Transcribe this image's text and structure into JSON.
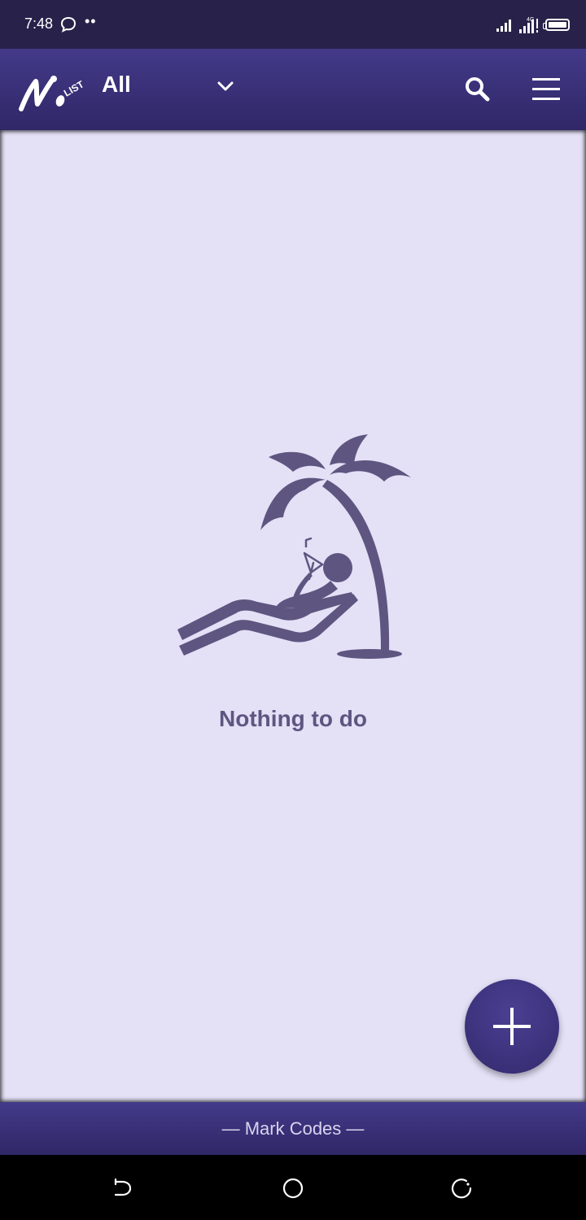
{
  "status_bar": {
    "time": "7:48",
    "dots": "••",
    "icons": [
      "chat-bubble-icon",
      "signal-icon",
      "signal-4g-icon",
      "battery-icon"
    ]
  },
  "app_bar": {
    "logo_text": "LIST",
    "filter_label": "All",
    "icons": [
      "chevron-down-icon",
      "search-icon",
      "menu-icon"
    ]
  },
  "empty_state": {
    "message": "Nothing to do",
    "illustration": "palm-tree-relaxing-person"
  },
  "fab": {
    "icon": "plus-icon"
  },
  "footer": {
    "text": "— Mark Codes —"
  },
  "nav_bar": {
    "icons": [
      "back-icon",
      "home-icon",
      "recent-apps-icon"
    ]
  },
  "colors": {
    "status_bar": "#28224a",
    "app_bar_top": "#433a8a",
    "app_bar_bottom": "#2f2766",
    "content_bg": "#e4e0f6",
    "illustration": "#5e5680",
    "fab": "#3a3077"
  }
}
